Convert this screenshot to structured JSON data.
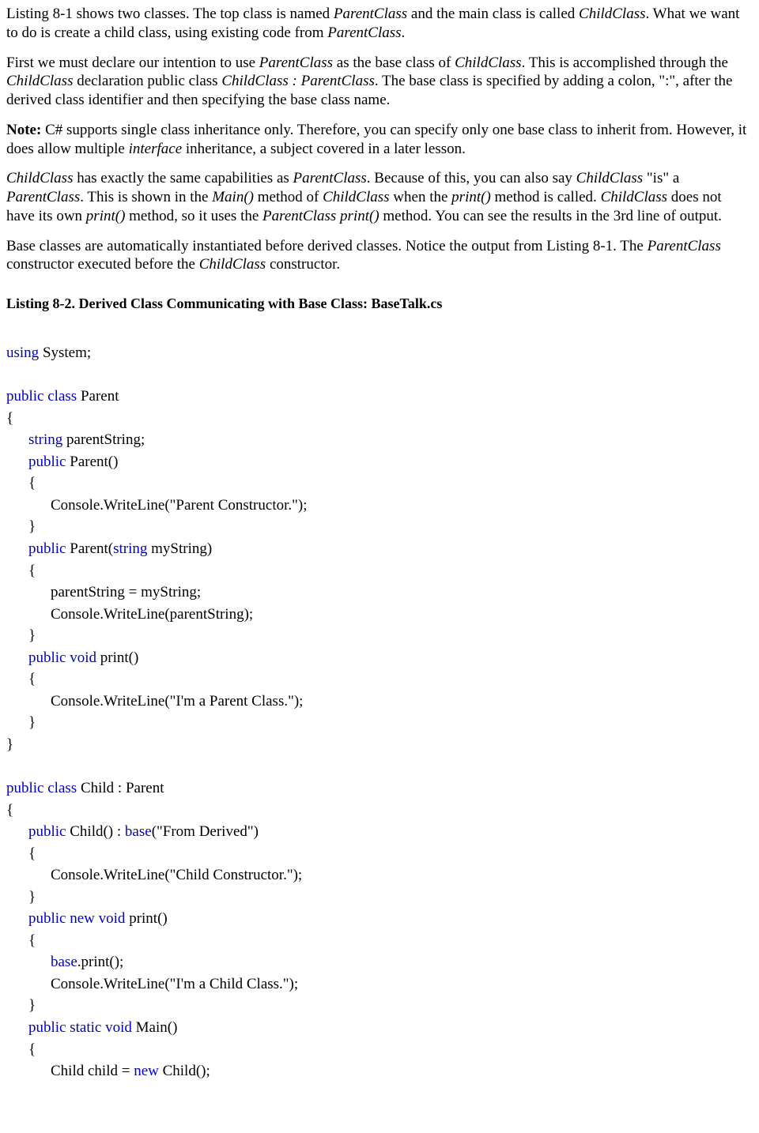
{
  "para1_a": "Listing 8-1 shows two classes. The top class is named ",
  "para1_b": "ParentClass",
  "para1_c": " and the main class is called ",
  "para1_d": "ChildClass",
  "para1_e": ". What we want to do is create a child class, using existing code from ",
  "para1_f": "ParentClass",
  "para1_g": ".",
  "para2_a": "First we must declare our intention to use ",
  "para2_b": "ParentClass",
  "para2_c": " as the base class of ",
  "para2_d": "ChildClass",
  "para2_e": ". This is accomplished through the ",
  "para2_f": "ChildClass",
  "para2_g": " declaration public class ",
  "para2_h": "ChildClass : ParentClass",
  "para2_i": ". The base class is specified by adding a colon, \":\", after the derived class identifier and then specifying the base class name.",
  "para3_a": "Note:",
  "para3_b": " C# supports single class inheritance only. Therefore, you can specify only one base class to inherit from. However, it does allow multiple ",
  "para3_c": "interface",
  "para3_d": " inheritance, a subject covered in a later lesson.",
  "para4_a": "ChildClass",
  "para4_b": " has exactly the same capabilities as ",
  "para4_c": "ParentClass",
  "para4_d": ". Because of this, you can also say ",
  "para4_e": "ChildClass",
  "para4_f": " \"is\" a ",
  "para4_g": "ParentClass",
  "para4_h": ". This is shown in the ",
  "para4_i": "Main()",
  "para4_j": " method of ",
  "para4_k": "ChildClass",
  "para4_l": " when the ",
  "para4_m": "print()",
  "para4_n": " method is called. ",
  "para4_o": "ChildClass",
  "para4_p": " does not have its own ",
  "para4_q": "print()",
  "para4_r": " method, so it uses the ",
  "para4_s": "ParentClass print()",
  "para4_t": " method. You can see the results in the 3rd line of output.",
  "para5_a": "Base classes are automatically instantiated before derived classes. Notice the output from Listing 8-1. The ",
  "para5_b": "ParentClass",
  "para5_c": " constructor executed before the ",
  "para5_d": "ChildClass",
  "para5_e": " constructor.",
  "listing_title": "Listing 8-2. Derived Class Communicating with Base Class: BaseTalk.cs",
  "kw": {
    "using": "using",
    "public": "public",
    "class": "class",
    "string": "string",
    "void": "void",
    "new": "new",
    "static": "static",
    "base": "base"
  },
  "code": {
    "using_system": " System;",
    "parent_decl": " Parent",
    "ob": "{",
    "cb": "}",
    "parentString_decl": " parentString;",
    "parent_ctor": " Parent()",
    "cw_parent_ctor": "Console.WriteLine(\"Parent Constructor.\");",
    "parent_ctor2a": " Parent(",
    "parent_ctor2b": " myString)",
    "assign": "parentString = myString;",
    "cw_parentString": "Console.WriteLine(parentString);",
    "print_sig": " print()",
    "cw_parent_class": "Console.WriteLine(\"I'm a Parent Class.\");",
    "child_decl": " Child : Parent",
    "child_ctor_a": " Child() : ",
    "child_ctor_b": "(\"From Derived\")",
    "cw_child_ctor": "Console.WriteLine(\"Child Constructor.\");",
    "base_print": ".print();",
    "cw_child_class": "Console.WriteLine(\"I'm a Child Class.\");",
    "main_sig": " Main()",
    "child_var_a": "Child child = ",
    "child_var_b": " Child();"
  }
}
